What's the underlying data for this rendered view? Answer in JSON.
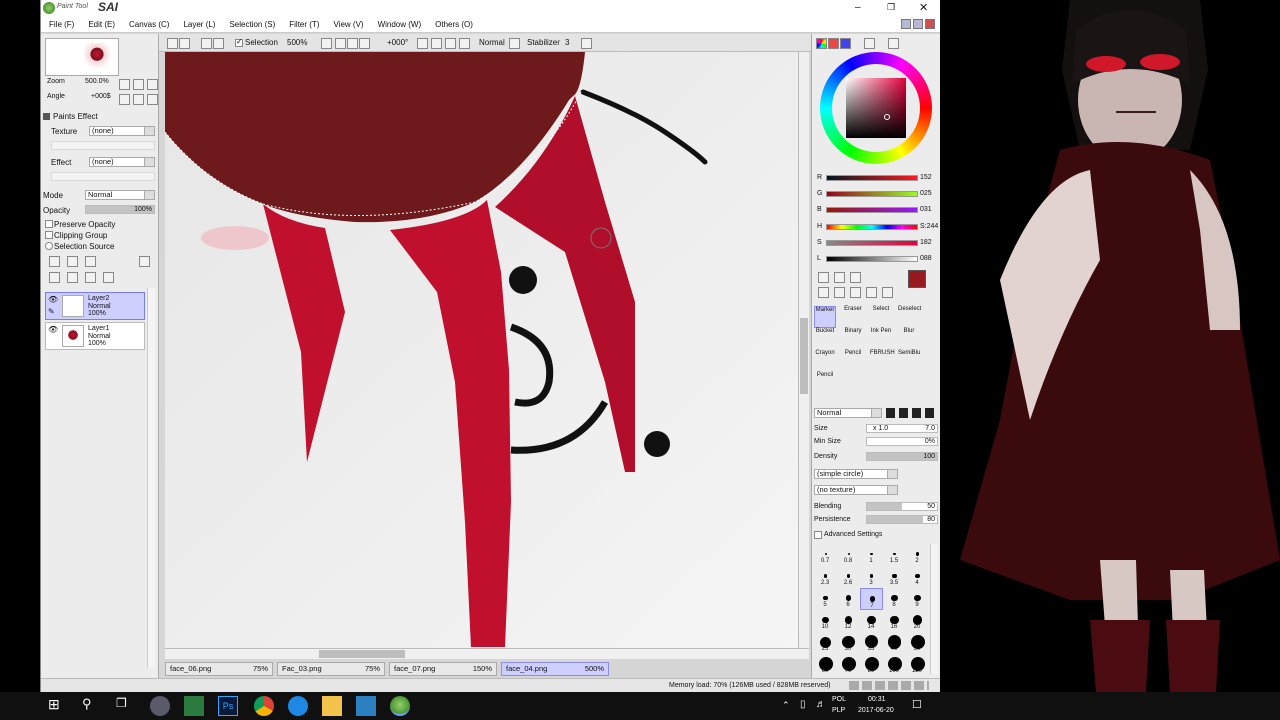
{
  "app": {
    "logo_text": "SAI",
    "logo_small": "Paint Tool"
  },
  "menu": [
    {
      "label": "File (F)"
    },
    {
      "label": "Edit (E)"
    },
    {
      "label": "Canvas (C)"
    },
    {
      "label": "Layer (L)"
    },
    {
      "label": "Selection (S)"
    },
    {
      "label": "Filter (T)"
    },
    {
      "label": "View (V)"
    },
    {
      "label": "Window (W)"
    },
    {
      "label": "Others (O)"
    }
  ],
  "toolbar": {
    "selection_label": "Selection",
    "zoom_value": "500%",
    "angle_value": "+000°",
    "blend_mode": "Normal",
    "stabilizer_label": "Stabilizer",
    "stabilizer_value": "3"
  },
  "navigator": {
    "zoom_label": "Zoom",
    "zoom_value": "500.0%",
    "angle_label": "Angle",
    "angle_value": "+000$"
  },
  "paints_effect": {
    "header": "Paints Effect",
    "texture_label": "Texture",
    "texture_value": "(none)",
    "effect_label": "Effect",
    "effect_value": "(none)"
  },
  "layer_props": {
    "mode_label": "Mode",
    "mode_value": "Normal",
    "opacity_label": "Opacity",
    "opacity_value": "100%",
    "opacity_fraction": 1.0,
    "preserve_opacity": "Preserve Opacity",
    "clipping_group": "Clipping Group",
    "selection_source": "Selection Source"
  },
  "layers": [
    {
      "name": "Layer2\nNormal\n100%",
      "selected": true
    },
    {
      "name": "Layer1\nNormal\n100%",
      "selected": false
    }
  ],
  "tabs": [
    {
      "name": "face_06.png",
      "zoom": "75%",
      "active": false
    },
    {
      "name": "Fac_03.png",
      "zoom": "75%",
      "active": false
    },
    {
      "name": "face_07.png",
      "zoom": "150%",
      "active": false
    },
    {
      "name": "face_04.png",
      "zoom": "500%",
      "active": true
    }
  ],
  "status": {
    "memory": "Memory load: 70% (126MB used / 828MB reserved)"
  },
  "color": {
    "R": "152",
    "G": "025",
    "B": "031",
    "H": "S:244",
    "S": "182",
    "V": "088",
    "current_hex": "#981920"
  },
  "tools": [
    {
      "label": "Marker",
      "selected": true
    },
    {
      "label": "Eraser",
      "selected": false
    },
    {
      "label": "Select",
      "selected": false
    },
    {
      "label": "Deselect",
      "selected": false
    },
    {
      "label": "Bucket",
      "selected": false
    },
    {
      "label": "Binary",
      "selected": false
    },
    {
      "label": "Ink Pen",
      "selected": false
    },
    {
      "label": "Blur",
      "selected": false
    },
    {
      "label": "Crayon",
      "selected": false
    },
    {
      "label": "Pencil",
      "selected": false
    },
    {
      "label": "FBRUSH",
      "selected": false
    },
    {
      "label": "SemiBlu",
      "selected": false
    },
    {
      "label": "Pencil",
      "selected": false
    }
  ],
  "brush": {
    "blend_mode": "Normal",
    "size_label": "Size",
    "size_mult": "x 1.0",
    "size_value": "7.0",
    "min_size_label": "Min Size",
    "min_size_value": "0%",
    "density_label": "Density",
    "density_value": "100",
    "shape": "(simple circle)",
    "texture": "(no texture)",
    "blending_label": "Blending",
    "blending_value": "50",
    "persistence_label": "Persistence",
    "persistence_value": "80",
    "advanced": "Advanced Settings"
  },
  "brush_sizes": [
    "0.7",
    "0.8",
    "1",
    "1.5",
    "2",
    "2.3",
    "2.6",
    "3",
    "3.5",
    "4",
    "5",
    "6",
    "7",
    "8",
    "9",
    "10",
    "12",
    "14",
    "16",
    "20",
    "25",
    "30",
    "35",
    "40",
    "50",
    "60",
    "70",
    "80",
    "100",
    "120"
  ],
  "selected_brush_size": "7",
  "taskbar": {
    "lang_top": "POL",
    "lang_bottom": "PLP",
    "time": "00:31",
    "date": "2017-06-20"
  }
}
